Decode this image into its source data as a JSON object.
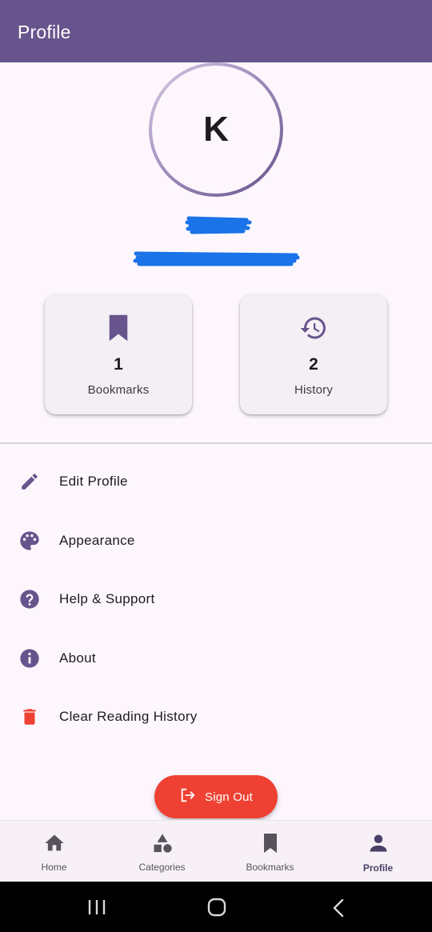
{
  "app_bar": {
    "title": "Profile"
  },
  "profile": {
    "initial": "K"
  },
  "stats": [
    {
      "icon": "bookmark-icon",
      "count": "1",
      "label": "Bookmarks"
    },
    {
      "icon": "history-icon",
      "count": "2",
      "label": "History"
    }
  ],
  "menu": [
    {
      "icon": "edit-pencil-icon",
      "label": "Edit Profile"
    },
    {
      "icon": "palette-icon",
      "label": "Appearance"
    },
    {
      "icon": "help-circle-icon",
      "label": "Help & Support"
    },
    {
      "icon": "info-circle-icon",
      "label": "About"
    },
    {
      "icon": "trash-icon",
      "label": "Clear Reading History"
    }
  ],
  "sign_out": {
    "icon": "logout-icon",
    "label": "Sign Out"
  },
  "bottom_nav": [
    {
      "icon": "home-icon",
      "label": "Home",
      "active": false
    },
    {
      "icon": "categories-icon",
      "label": "Categories",
      "active": false
    },
    {
      "icon": "bookmark-icon",
      "label": "Bookmarks",
      "active": false
    },
    {
      "icon": "person-icon",
      "label": "Profile",
      "active": true
    }
  ],
  "colors": {
    "primary": "#67548c",
    "danger": "#ef4133",
    "redaction": "#1a73e8",
    "background": "#fdf7fd"
  }
}
